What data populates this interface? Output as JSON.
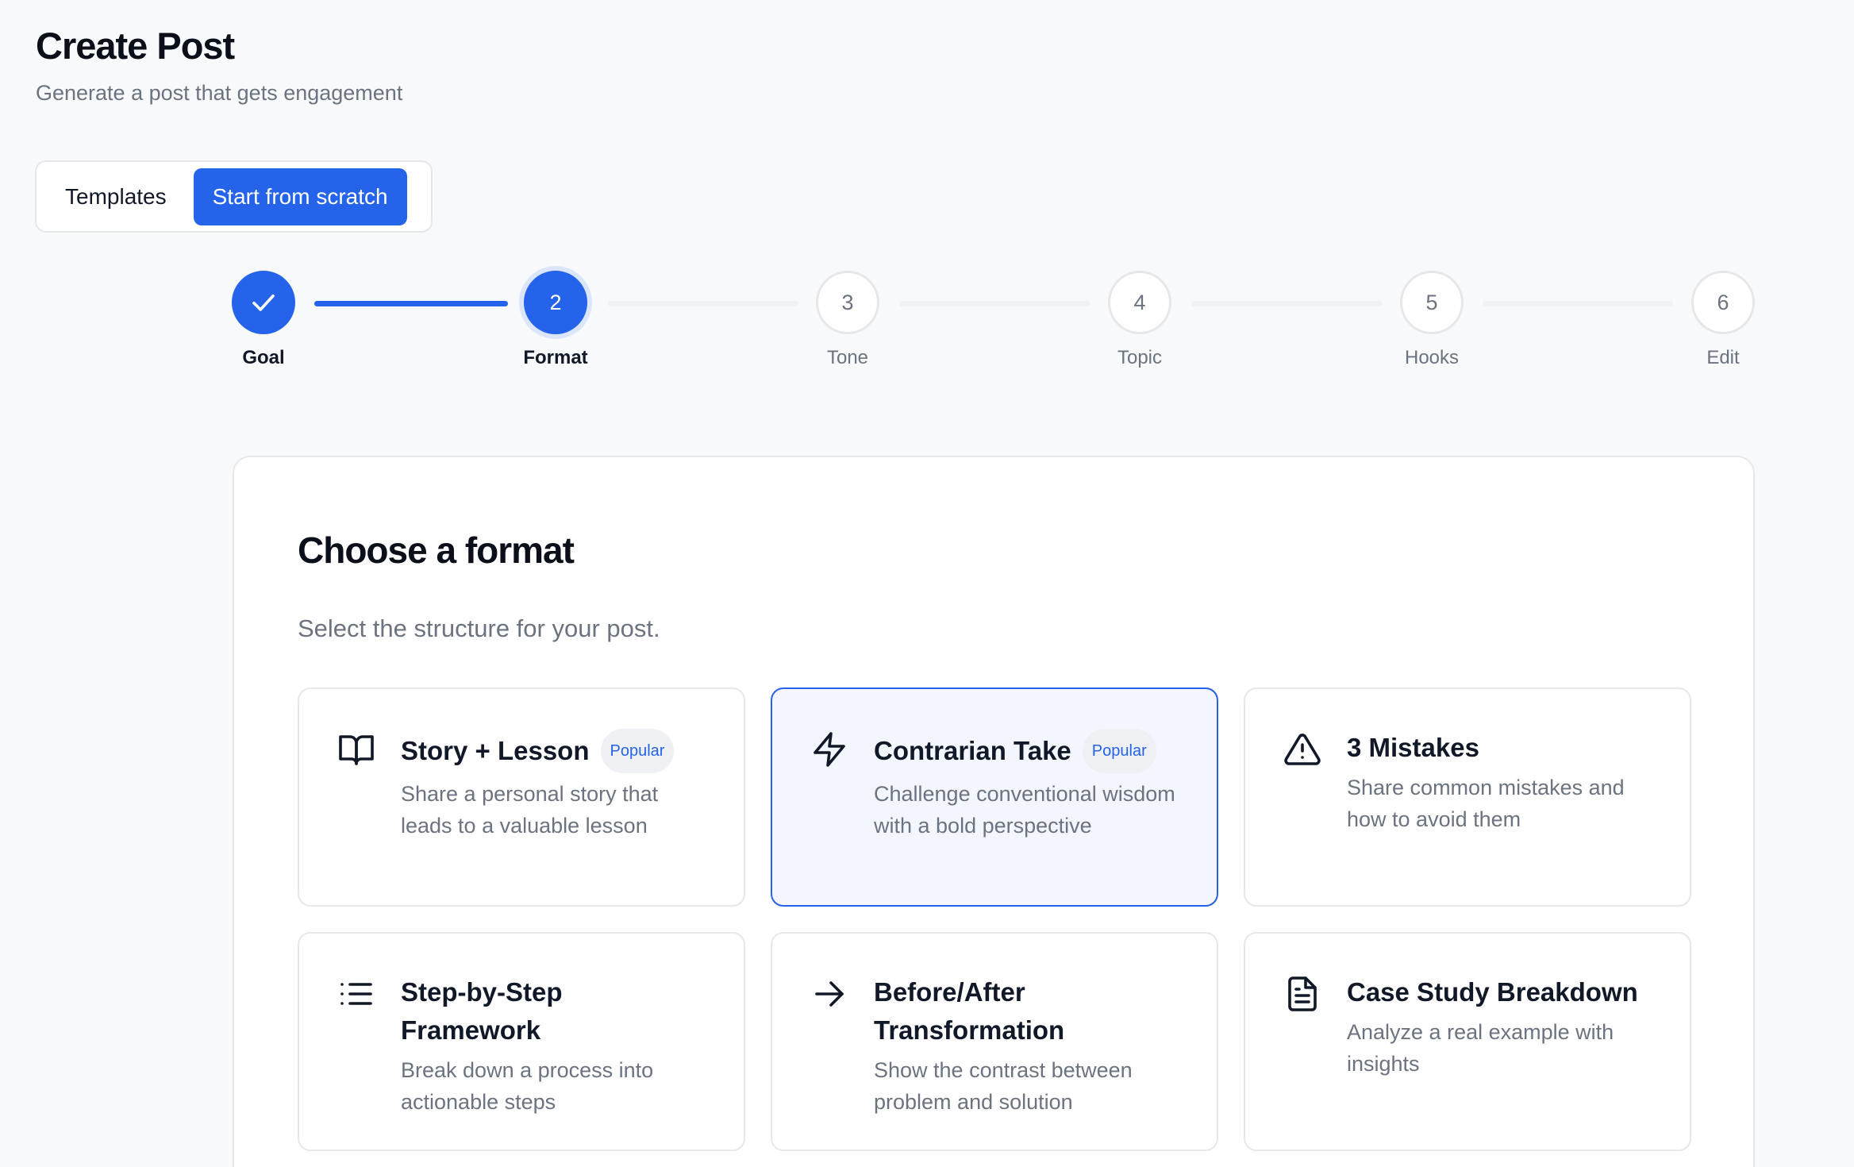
{
  "header": {
    "title": "Create Post",
    "subtitle": "Generate a post that gets engagement"
  },
  "mode_toggle": {
    "templates_label": "Templates",
    "scratch_label": "Start from scratch",
    "active": "scratch"
  },
  "stepper": {
    "current_step": 2,
    "steps": [
      {
        "number": "1",
        "label": "Goal",
        "status": "done"
      },
      {
        "number": "2",
        "label": "Format",
        "status": "current"
      },
      {
        "number": "3",
        "label": "Tone",
        "status": "upcoming"
      },
      {
        "number": "4",
        "label": "Topic",
        "status": "upcoming"
      },
      {
        "number": "5",
        "label": "Hooks",
        "status": "upcoming"
      },
      {
        "number": "6",
        "label": "Edit",
        "status": "upcoming"
      }
    ]
  },
  "format_section": {
    "title": "Choose a format",
    "subtitle": "Select the structure for your post.",
    "options": [
      {
        "name": "Story + Lesson",
        "badge": "Popular",
        "description": "Share a personal story that leads to a valuable lesson",
        "icon": "book-open-icon",
        "selected": false
      },
      {
        "name": "Contrarian Take",
        "badge": "Popular",
        "description": "Challenge conventional wisdom with a bold perspective",
        "icon": "lightning-icon",
        "selected": true
      },
      {
        "name": "3 Mistakes",
        "badge": "",
        "description": "Share common mistakes and how to avoid them",
        "icon": "warning-triangle-icon",
        "selected": false
      },
      {
        "name": "Step-by-Step Framework",
        "badge": "",
        "description": "Break down a process into actionable steps",
        "icon": "list-icon",
        "selected": false
      },
      {
        "name": "Before/After Transformation",
        "badge": "",
        "description": "Show the contrast between problem and solution",
        "icon": "arrow-right-icon",
        "selected": false
      },
      {
        "name": "Case Study Breakdown",
        "badge": "",
        "description": "Analyze a real example with insights",
        "icon": "document-icon",
        "selected": false
      }
    ]
  },
  "colors": {
    "accent": "#2563eb",
    "background": "#f8f9fa",
    "muted_text": "#6b7280",
    "selected_card_bg": "#f3f6fe"
  }
}
